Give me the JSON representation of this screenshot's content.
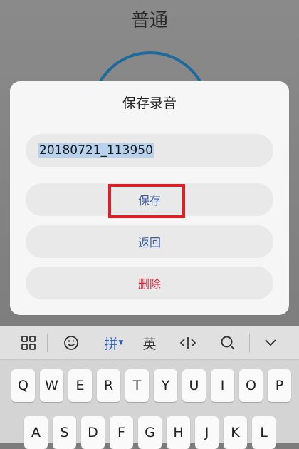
{
  "background": {
    "title": "普通"
  },
  "dialog": {
    "title": "保存录音",
    "filename": "20180721_113950",
    "save_label": "保存",
    "back_label": "返回",
    "delete_label": "删除",
    "colors": {
      "save": "#3a5fa8",
      "back": "#3a5fa8",
      "delete": "#d22a3c",
      "highlight": "#e21d24"
    }
  },
  "keyboard": {
    "toolbar": {
      "pinyin": "拼",
      "english": "英"
    },
    "row1": [
      "Q",
      "W",
      "E",
      "R",
      "T",
      "Y",
      "U",
      "I",
      "O",
      "P"
    ],
    "row2": [
      "A",
      "S",
      "D",
      "F",
      "G",
      "H",
      "J",
      "K",
      "L"
    ]
  }
}
